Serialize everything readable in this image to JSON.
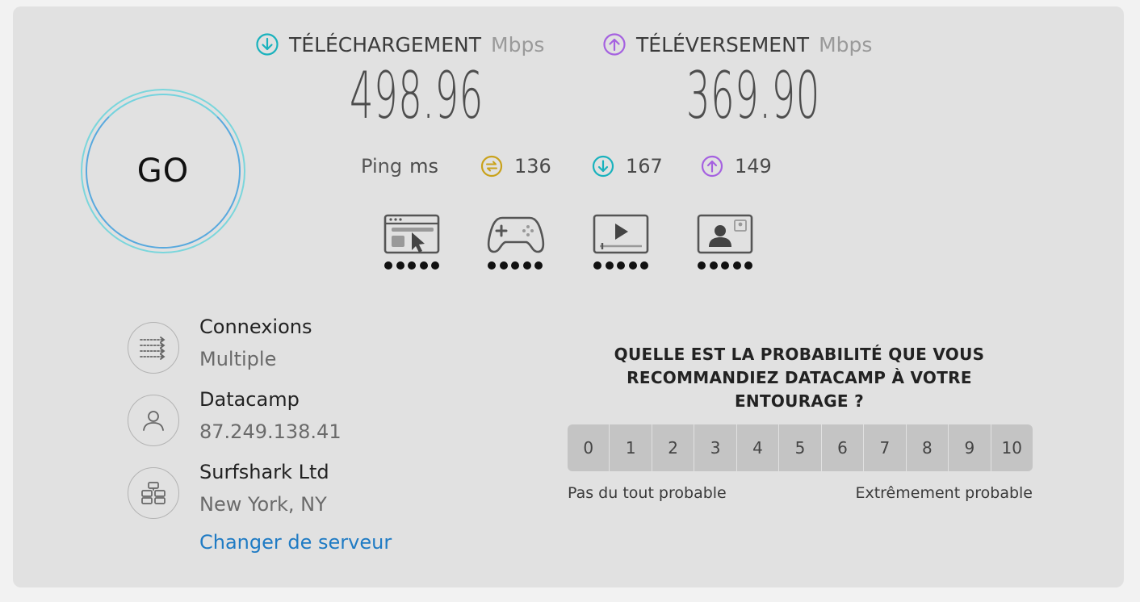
{
  "colors": {
    "download": "#19b2bd",
    "upload": "#a561e0",
    "ping": "#c9a21b",
    "link": "#1f7bc4"
  },
  "start": {
    "label": "GO"
  },
  "download": {
    "label": "TÉLÉCHARGEMENT",
    "unit": "Mbps",
    "value": "498.96",
    "icon": "arrow-down-circle-icon"
  },
  "upload": {
    "label": "TÉLÉVERSEMENT",
    "unit": "Mbps",
    "value": "369.90",
    "icon": "arrow-up-circle-icon"
  },
  "ping": {
    "label": "Ping",
    "unit": "ms",
    "idle": "136",
    "download": "167",
    "upload": "149"
  },
  "quality_icons": [
    {
      "icon": "web-browsing-icon",
      "rating": 5
    },
    {
      "icon": "gamepad-icon",
      "rating": 5
    },
    {
      "icon": "video-streaming-icon",
      "rating": 5
    },
    {
      "icon": "video-call-icon",
      "rating": 5
    }
  ],
  "connections": {
    "title": "Connexions",
    "value": "Multiple",
    "icon": "connections-icon"
  },
  "provider": {
    "title": "Datacamp",
    "ip": "87.249.138.41",
    "icon": "user-icon"
  },
  "server": {
    "title": "Surfshark Ltd",
    "location": "New York, NY",
    "icon": "server-icon",
    "change_link": "Changer de serveur"
  },
  "survey": {
    "question": "QUELLE EST LA PROBABILITÉ QUE VOUS RECOMMANDIEZ DATACAMP À VOTRE ENTOURAGE ?",
    "scale": [
      "0",
      "1",
      "2",
      "3",
      "4",
      "5",
      "6",
      "7",
      "8",
      "9",
      "10"
    ],
    "min_label": "Pas du tout probable",
    "max_label": "Extrêmement probable"
  }
}
